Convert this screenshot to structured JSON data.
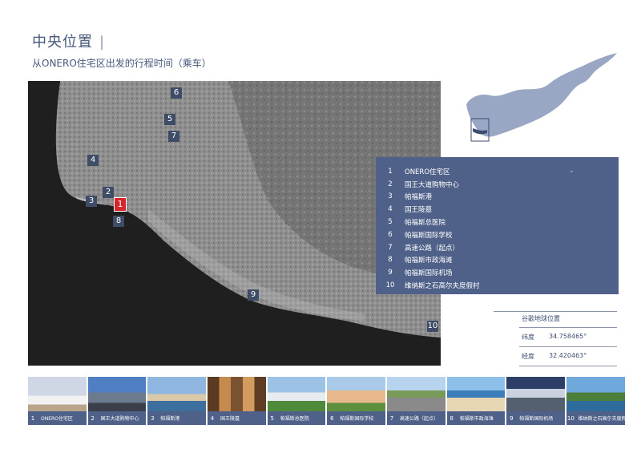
{
  "title": "中央位置",
  "title_divider": "|",
  "subtitle": "从ONERO住宅区出发的行程时间（乘车）",
  "map": {
    "markers": [
      "1",
      "2",
      "3",
      "4",
      "5",
      "6",
      "7",
      "8",
      "9",
      "10"
    ]
  },
  "legend": {
    "items": [
      {
        "num": "1",
        "label": "ONERO住宅区",
        "extra": "-"
      },
      {
        "num": "2",
        "label": "国王大道购物中心"
      },
      {
        "num": "3",
        "label": "帕福斯港"
      },
      {
        "num": "4",
        "label": "国王陵墓"
      },
      {
        "num": "5",
        "label": "帕福斯总医院"
      },
      {
        "num": "6",
        "label": "帕福斯国际学校"
      },
      {
        "num": "7",
        "label": "高速公路（起点）"
      },
      {
        "num": "8",
        "label": "帕福斯市政海滩"
      },
      {
        "num": "9",
        "label": "帕福斯国际机场"
      },
      {
        "num": "10",
        "label": "维纳斯之石高尔夫度假村"
      }
    ]
  },
  "coordinates": {
    "heading": "谷歌地球位置",
    "latitude_label": "纬度",
    "latitude_value": "34.758465°",
    "longitude_label": "经度",
    "longitude_value": "32.420463°"
  },
  "thumbnails": [
    {
      "num": "1",
      "caption": "ONERO住宅区"
    },
    {
      "num": "2",
      "caption": "国王大道购物中心"
    },
    {
      "num": "3",
      "caption": "帕福斯港"
    },
    {
      "num": "4",
      "caption": "国王陵墓"
    },
    {
      "num": "5",
      "caption": "帕福斯总医院"
    },
    {
      "num": "6",
      "caption": "帕福斯国际学校"
    },
    {
      "num": "7",
      "caption": "高速公路（起点）"
    },
    {
      "num": "8",
      "caption": "帕福斯市政海滩"
    },
    {
      "num": "9",
      "caption": "帕福斯国际机场"
    },
    {
      "num": "10",
      "caption": "维纳斯之石高尔夫度假村"
    }
  ],
  "colors": {
    "accent": "#4f6188",
    "active_marker": "#d6262c",
    "island": "#9aa7c4"
  }
}
